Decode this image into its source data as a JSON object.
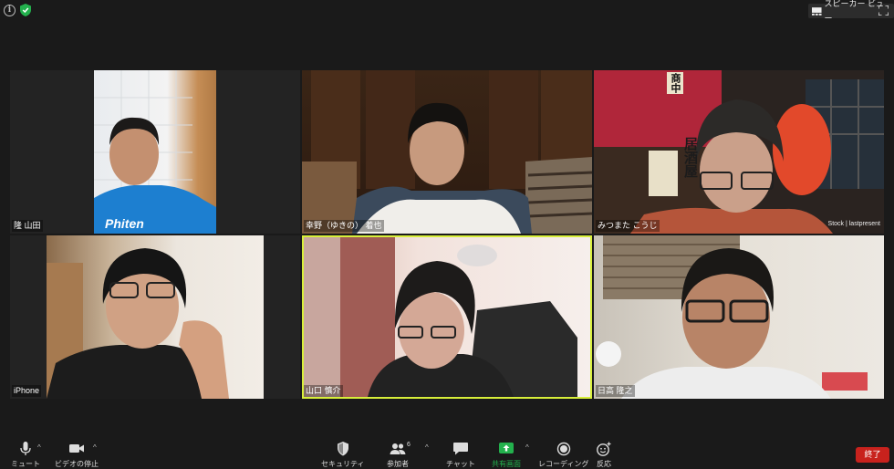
{
  "topbar": {
    "speaker_view_label": "スピーカー ビュー"
  },
  "participants": [
    {
      "name": "隆 山田"
    },
    {
      "name": "幸野（ゆきの） 着也"
    },
    {
      "name": "みつまた こうじ",
      "watermark": "Stock | lastpresent",
      "lantern_text": "居酒屋"
    },
    {
      "name": "iPhone"
    },
    {
      "name": "山口 慎介",
      "active": true
    },
    {
      "name": "日高 隆之"
    }
  ],
  "toolbar": {
    "mute_label": "ミュート",
    "video_label": "ビデオの停止",
    "security_label": "セキュリティ",
    "participants_label": "参加者",
    "participants_count": "6",
    "chat_label": "チャット",
    "share_label": "共有画面",
    "record_label": "レコーディング",
    "reactions_label": "反応",
    "end_label": "終了"
  },
  "colors": {
    "active_speaker": "#d8ef3a",
    "share_green": "#23b14d",
    "end_red": "#c8221d"
  }
}
